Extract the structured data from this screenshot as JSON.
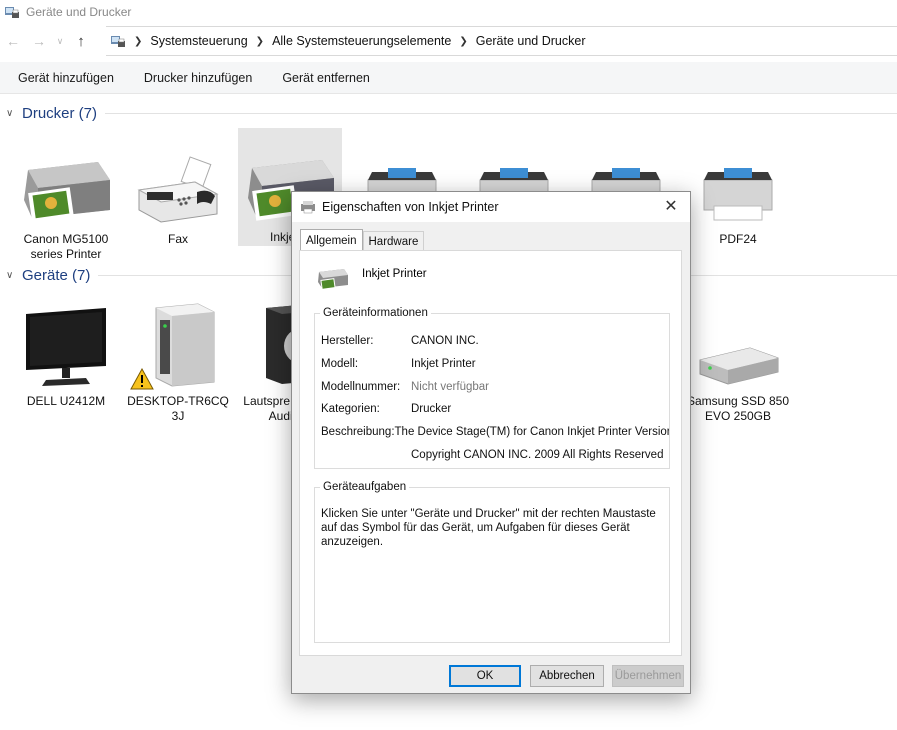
{
  "window": {
    "title": "Geräte und Drucker",
    "icon": "devices-and-printers-icon"
  },
  "address": {
    "back_icon": "arrow-left-icon",
    "forward_icon": "arrow-right-icon",
    "recent_icon": "chevron-down-icon",
    "up_icon": "arrow-up-icon",
    "breadcrumbs": [
      "Systemsteuerung",
      "Alle Systemsteuerungselemente",
      "Geräte und Drucker"
    ]
  },
  "commands": [
    "Gerät hinzufügen",
    "Drucker hinzufügen",
    "Gerät entfernen"
  ],
  "groups": {
    "printers": {
      "title": "Drucker (7)",
      "items": [
        {
          "label": "Canon MG5100 series Printer",
          "icon": "multifunction-printer-icon"
        },
        {
          "label": "Fax",
          "icon": "fax-icon"
        },
        {
          "label": "Inkjet P",
          "icon": "multifunction-printer-icon",
          "selected": true
        },
        {
          "label": "",
          "icon": "printer-icon"
        },
        {
          "label": "",
          "icon": "printer-icon"
        },
        {
          "label": "",
          "icon": "printer-icon"
        },
        {
          "label": "PDF24",
          "icon": "printer-icon"
        }
      ]
    },
    "devices": {
      "title": "Geräte (7)",
      "items": [
        {
          "label": "DELL U2412M",
          "icon": "monitor-icon"
        },
        {
          "label": "DESKTOP-TR6CQ 3J",
          "icon": "computer-tower-icon",
          "warning": true
        },
        {
          "label": "Lautspre High De Audio D",
          "icon": "speaker-icon"
        },
        {
          "label": "Samsung SSD 850 EVO 250GB",
          "icon": "drive-icon"
        }
      ]
    }
  },
  "dialog": {
    "title": "Eigenschaften von Inkjet Printer",
    "close_icon": "close-icon",
    "tabs": [
      "Allgemein",
      "Hardware"
    ],
    "device_name": "Inkjet Printer",
    "info_legend": "Geräteinformationen",
    "info": [
      {
        "key": "Hersteller:",
        "value": "CANON INC."
      },
      {
        "key": "Modell:",
        "value": "Inkjet Printer"
      },
      {
        "key": "Modellnummer:",
        "value": "Nicht verfügbar"
      },
      {
        "key": "Kategorien:",
        "value": "Drucker"
      },
      {
        "key": "Beschreibung:",
        "value": "The Device Stage(TM) for Canon Inkjet Printer Versior"
      },
      {
        "key": "",
        "value": "Copyright CANON INC. 2009 All Rights Reserved"
      }
    ],
    "tasks_legend": "Geräteaufgaben",
    "tasks_text": "Klicken Sie unter \"Geräte und Drucker\" mit der rechten Maustaste auf das Symbol für das Gerät, um Aufgaben für dieses Gerät anzuzeigen.",
    "buttons": {
      "ok": "OK",
      "cancel": "Abbrechen",
      "apply": "Übernehmen"
    }
  }
}
